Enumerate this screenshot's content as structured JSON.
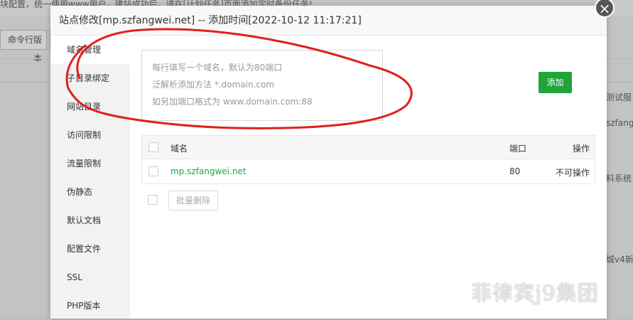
{
  "background": {
    "top_note": "块配置，统一使用www用户，建站成功后，请在[计划任务]页面添加定时备份任务!",
    "cmd_tab": "命令行版本",
    "right_texts": [
      "测试服",
      "szfang",
      "料系统",
      "城v4新"
    ]
  },
  "modal": {
    "title": "站点修改[mp.szfangwei.net] -- 添加时间[2022-10-12 11:17:21]",
    "close_label": "×",
    "sidebar": [
      {
        "label": "域名管理",
        "active": true
      },
      {
        "label": "子目录绑定"
      },
      {
        "label": "网站目录"
      },
      {
        "label": "访问限制"
      },
      {
        "label": "流量限制"
      },
      {
        "label": "伪静态"
      },
      {
        "label": "默认文档"
      },
      {
        "label": "配置文件"
      },
      {
        "label": "SSL"
      },
      {
        "label": "PHP版本"
      }
    ],
    "domain_input": {
      "placeholder_lines": [
        "每行填写一个域名，默认为80端口",
        "泛解析添加方法 *.domain.com",
        "如另加端口格式为 www.domain.com:88"
      ]
    },
    "add_button": "添加",
    "table": {
      "columns": {
        "domain": "域名",
        "port": "端口",
        "action": "操作"
      },
      "rows": [
        {
          "domain": "mp.szfangwei.net",
          "port": "80",
          "action": "不可操作"
        }
      ]
    },
    "batch_delete": "批量删除"
  },
  "watermark": "菲律宾j9集团",
  "colors": {
    "accent": "#20a53a",
    "annotation": "#e0201c"
  }
}
